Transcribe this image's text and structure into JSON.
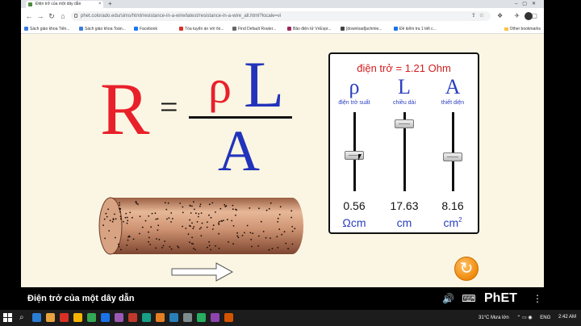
{
  "browser": {
    "tab_title": "Điện trở của một dây dẫn",
    "tab_close": "×",
    "new_tab": "+",
    "window_controls": "–▢✕",
    "back": "←",
    "forward": "→",
    "reload": "↻",
    "home": "⌂",
    "url": "phet.colorado.edu/sims/html/resistance-in-a-wire/latest/resistance-in-a-wire_all.html?locale=vi",
    "address_actions": "⇪☆",
    "toolbar_icons": "❖ ✈ ▢",
    "bookmarks": [
      {
        "label": "Sách giáo khoa Tiến...",
        "color": "#3b7ddd"
      },
      {
        "label": "Sách giáo khoa Toán...",
        "color": "#3b7ddd"
      },
      {
        "label": "Facebook",
        "color": "#1877f2"
      },
      {
        "label": "Tòa tuyển án với ôn...",
        "color": "#d93025"
      },
      {
        "label": "Find Default Router...",
        "color": "#666666"
      },
      {
        "label": "Bảo điện tử VnExpr...",
        "color": "#9c2a5a"
      },
      {
        "label": "[download]achmie...",
        "color": "#444444"
      },
      {
        "label": "Đề kiểm tra 1 tiết c...",
        "color": "#1a73e8"
      }
    ],
    "other_bookmarks": "Other bookmarks"
  },
  "simulation": {
    "equation": {
      "R": "R",
      "equals": "=",
      "rho": "ρ",
      "L": "L",
      "A": "A"
    },
    "resistance_readout": "điện trở = 1.21 Ohm",
    "sliders": [
      {
        "symbol": "ρ",
        "name": "điện trở suất",
        "value": "0.56",
        "unit": "Ωcm",
        "unit_sup": "",
        "color": "#2b3fc0",
        "level": 0.46
      },
      {
        "symbol": "L",
        "name": "chiều dài",
        "value": "17.63",
        "unit": "cm",
        "unit_sup": "",
        "color": "#2b3fc0",
        "level": 0.86
      },
      {
        "symbol": "A",
        "name": "thiết diện",
        "value": "8.16",
        "unit": "cm",
        "unit_sup": "2",
        "color": "#2b3fc0",
        "level": 0.44
      }
    ],
    "reset_icon": "↻",
    "title": "Điện trở của một dây dẫn",
    "footer_icons": "🔊 ⌨",
    "logo": "PhET",
    "menu": "⋮"
  },
  "taskbar": {
    "search_icon": "⌕",
    "weather": "31°C  Mưa lớn",
    "tray_icons": "⌃ ▭ ◉",
    "language": "ENG",
    "time": "2:42 AM",
    "apps": [
      "#2b7cd3",
      "#e8a33d",
      "#d93025",
      "#f4b400",
      "#34a853",
      "#1a73e8",
      "#9b59b6",
      "#c0392b",
      "#16a085",
      "#e67e22",
      "#2980b9",
      "#7f8c8d",
      "#27ae60",
      "#8e44ad",
      "#d35400"
    ]
  },
  "colors": {
    "sim_background": "#fbf6e3",
    "resistance_red": "#d21d1d",
    "equation_red": "#e8202a",
    "equation_blue": "#2233bb",
    "wire_brown": "#c98e6a"
  }
}
